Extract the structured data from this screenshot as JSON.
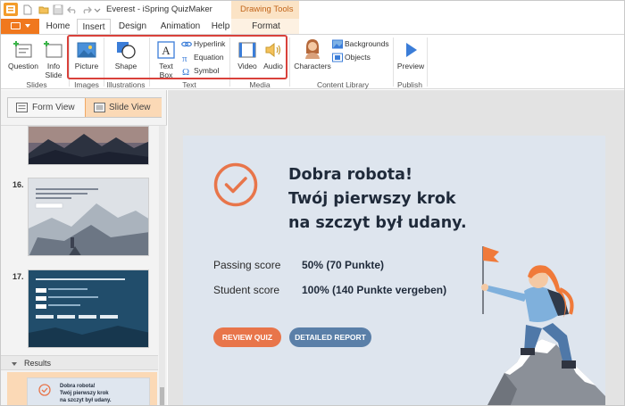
{
  "window": {
    "title": "Everest - iSpring QuizMaker",
    "context_tab_group": "Drawing Tools"
  },
  "tabs": [
    {
      "label": "Home"
    },
    {
      "label": "Insert",
      "active": true
    },
    {
      "label": "Design"
    },
    {
      "label": "Animation"
    },
    {
      "label": "Help"
    },
    {
      "label": "Format"
    }
  ],
  "ribbon": {
    "slides": {
      "question": "Question",
      "info_slide_line1": "Info",
      "info_slide_line2": "Slide",
      "group": "Slides"
    },
    "images": {
      "picture": "Picture",
      "group": "Images"
    },
    "illustrations": {
      "shape": "Shape",
      "group": "Illustrations"
    },
    "text": {
      "text_box_line1": "Text",
      "text_box_line2": "Box",
      "hyperlink": "Hyperlink",
      "equation": "Equation",
      "symbol": "Symbol",
      "group": "Text"
    },
    "media": {
      "video": "Video",
      "audio": "Audio",
      "group": "Media"
    },
    "content_library": {
      "characters": "Characters",
      "backgrounds": "Backgrounds",
      "objects": "Objects",
      "group": "Content Library"
    },
    "publish": {
      "preview": "Preview",
      "group": "Publish"
    }
  },
  "view_toggle": {
    "form_view": "Form View",
    "slide_view": "Slide View",
    "selected": "Slide View"
  },
  "slides_panel": {
    "slides": [
      {
        "number": "16."
      },
      {
        "number": "17."
      }
    ],
    "results_label": "Results",
    "result_thumb_lines": [
      "Dobra robota!",
      "Twój pierwszy krok",
      "na szczyt był udany."
    ]
  },
  "slide": {
    "heading_lines": [
      "Dobra robota!",
      "Twój pierwszy krok",
      "na szczyt był udany."
    ],
    "passing_score_label": "Passing score",
    "passing_score_value": "50% (70 Punkte)",
    "student_score_label": "Student score",
    "student_score_value": "100% (140 Punkte vergeben)",
    "review_button": "REVIEW QUIZ",
    "report_button": "DETAILED REPORT"
  },
  "colors": {
    "accent_orange": "#f0781e",
    "check_orange": "#e8754a",
    "review_button": "#e8754a",
    "report_button": "#5a7fa8",
    "slide_background": "#dee5ee",
    "highlight_red": "#d9413b"
  }
}
